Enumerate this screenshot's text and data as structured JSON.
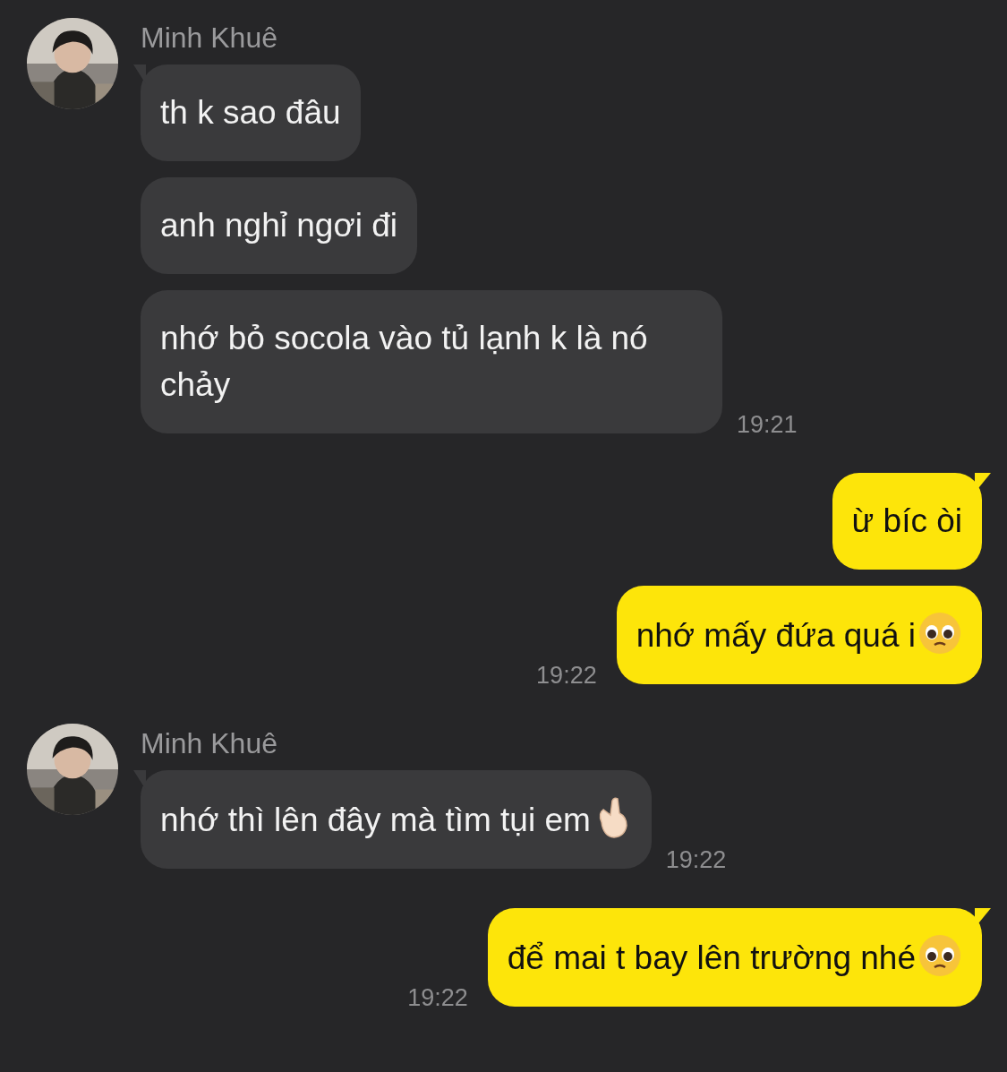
{
  "messages": [
    {
      "kind": "incoming",
      "sender": "Minh Khuê",
      "avatar": {
        "kind": "picture"
      },
      "bubbles": [
        {
          "text": "th k sao đâu"
        },
        {
          "text": "anh nghỉ ngơi đi"
        },
        {
          "text": "nhớ bỏ socola vào tủ lạnh k là nó chảy"
        }
      ],
      "time": "19:21"
    },
    {
      "kind": "outgoing",
      "bubbles": [
        {
          "text": "ừ bíc òi"
        },
        {
          "text": "nhớ mấy đứa quá i",
          "kind": "pleading"
        }
      ],
      "time": "19:22"
    },
    {
      "kind": "incoming",
      "sender": "Minh Khuê",
      "avatar": {
        "kind": "picture"
      },
      "bubbles": [
        {
          "text": "nhớ thì lên đây mà tìm tụi em",
          "kind": "fingers"
        }
      ],
      "time": "19:22"
    },
    {
      "kind": "outgoing",
      "bubbles": [
        {
          "text": "để mai t bay lên trường nhé",
          "kind": "pleading"
        }
      ],
      "time": "19:22"
    }
  ]
}
